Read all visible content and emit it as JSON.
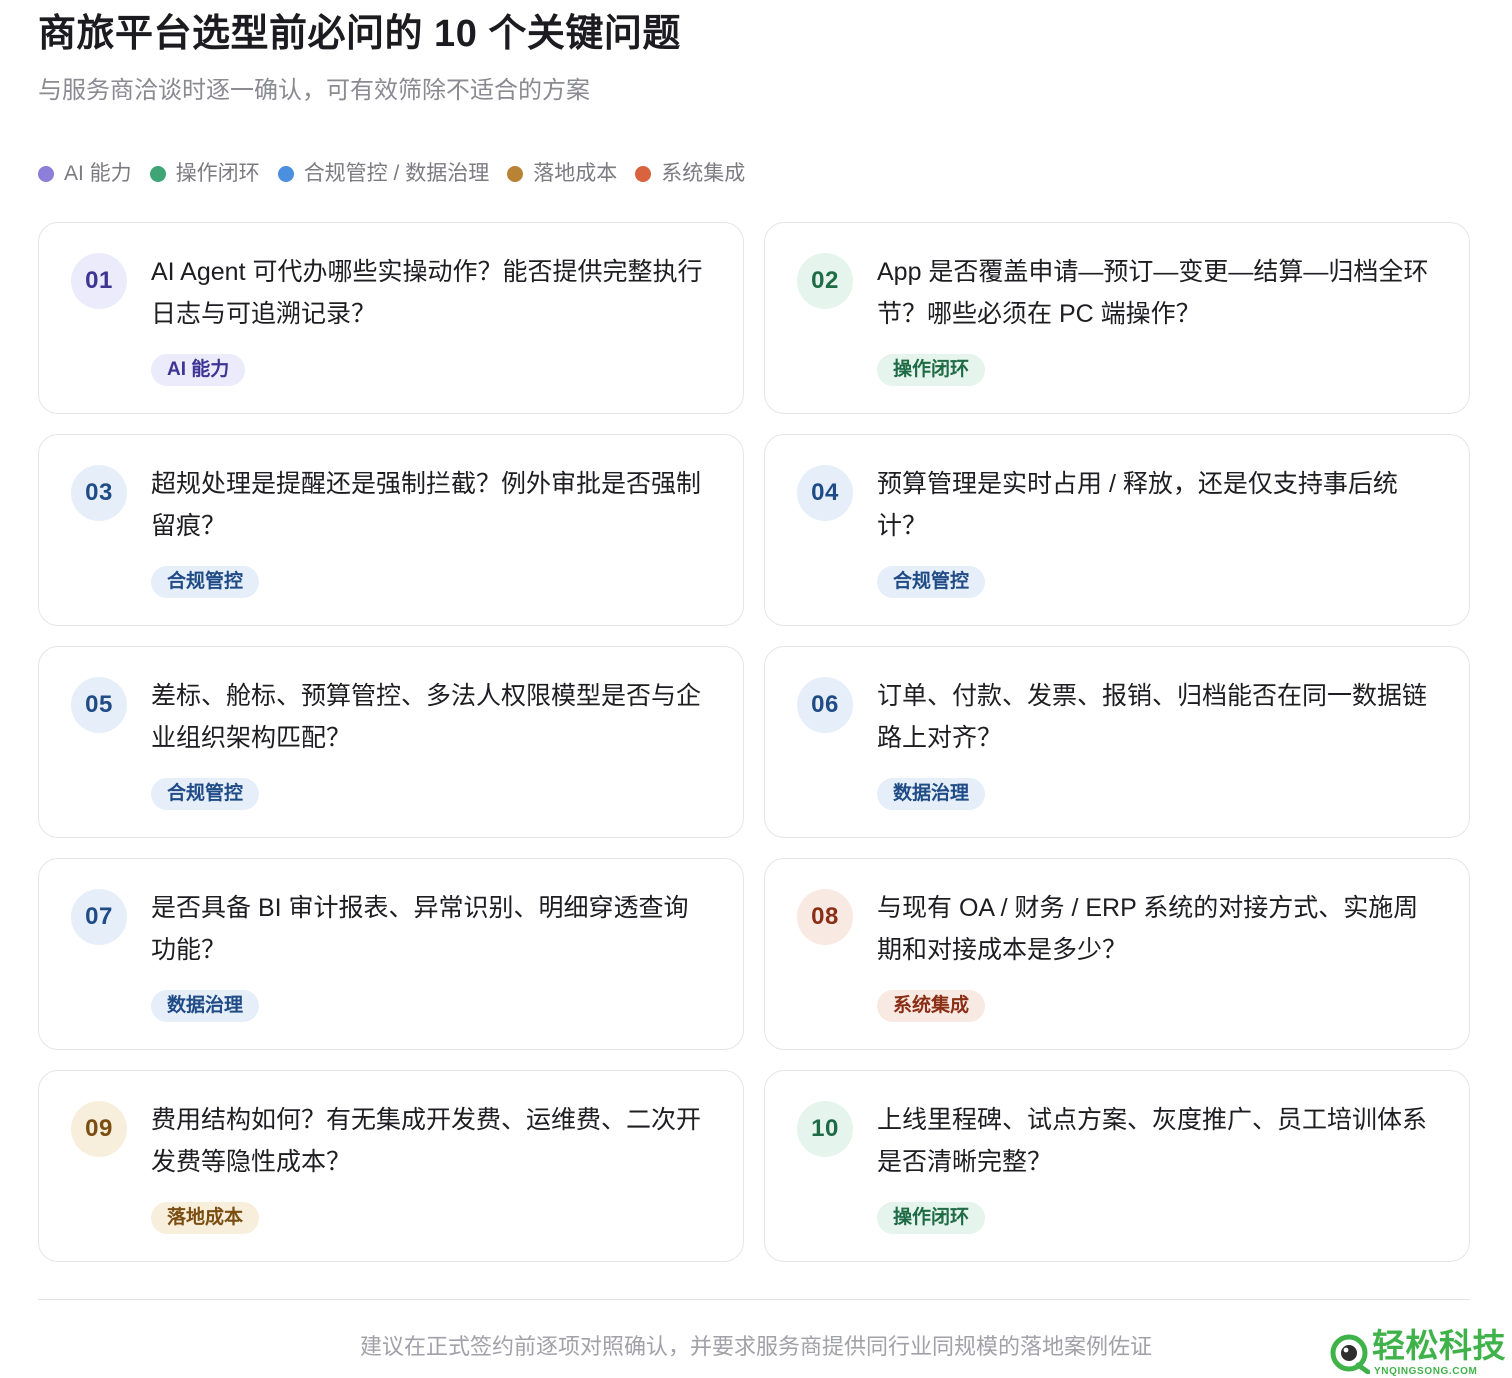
{
  "header": {
    "title": "商旅平台选型前必问的 10 个关键问题",
    "subtitle": "与服务商洽谈时逐一确认，可有效筛除不适合的方案"
  },
  "legend": [
    {
      "label": "AI 能力",
      "color": "#8b7fd9"
    },
    {
      "label": "操作闭环",
      "color": "#3fa476"
    },
    {
      "label": "合规管控 / 数据治理",
      "color": "#4a8fe0"
    },
    {
      "label": "落地成本",
      "color": "#b88335"
    },
    {
      "label": "系统集成",
      "color": "#d9623f"
    }
  ],
  "categories": {
    "ai": {
      "badge_bg": "#ecebfb",
      "badge_fg": "#3d3493",
      "tag_bg": "#ecebfb",
      "tag_fg": "#3d3493"
    },
    "ops": {
      "badge_bg": "#e5f4ec",
      "badge_fg": "#1f6b45",
      "tag_bg": "#e5f4ec",
      "tag_fg": "#1f6b45"
    },
    "compliance": {
      "badge_bg": "#e6eef9",
      "badge_fg": "#1f4b86",
      "tag_bg": "#e6eef9",
      "tag_fg": "#1f4b86"
    },
    "cost": {
      "badge_bg": "#f8eedc",
      "badge_fg": "#7a4d10",
      "tag_bg": "#f8eedc",
      "tag_fg": "#7a4d10"
    },
    "integration": {
      "badge_bg": "#f9e9e3",
      "badge_fg": "#8a2f15",
      "tag_bg": "#f9e9e3",
      "tag_fg": "#8a2f15"
    }
  },
  "cards": [
    {
      "num": "01",
      "question": "AI Agent 可代办哪些实操动作？能否提供完整执行日志与可追溯记录？",
      "tag": "AI 能力",
      "category": "ai"
    },
    {
      "num": "02",
      "question": "App 是否覆盖申请—预订—变更—结算—归档全环节？哪些必须在 PC 端操作？",
      "tag": "操作闭环",
      "category": "ops"
    },
    {
      "num": "03",
      "question": "超规处理是提醒还是强制拦截？例外审批是否强制留痕？",
      "tag": "合规管控",
      "category": "compliance"
    },
    {
      "num": "04",
      "question": "预算管理是实时占用 / 释放，还是仅支持事后统计？",
      "tag": "合规管控",
      "category": "compliance"
    },
    {
      "num": "05",
      "question": "差标、舱标、预算管控、多法人权限模型是否与企业组织架构匹配？",
      "tag": "合规管控",
      "category": "compliance"
    },
    {
      "num": "06",
      "question": "订单、付款、发票、报销、归档能否在同一数据链路上对齐？",
      "tag": "数据治理",
      "category": "compliance"
    },
    {
      "num": "07",
      "question": "是否具备 BI 审计报表、异常识别、明细穿透查询功能？",
      "tag": "数据治理",
      "category": "compliance"
    },
    {
      "num": "08",
      "question": "与现有 OA / 财务 / ERP 系统的对接方式、实施周期和对接成本是多少？",
      "tag": "系统集成",
      "category": "integration"
    },
    {
      "num": "09",
      "question": "费用结构如何？有无集成开发费、运维费、二次开发费等隐性成本？",
      "tag": "落地成本",
      "category": "cost"
    },
    {
      "num": "10",
      "question": "上线里程碑、试点方案、灰度推广、员工培训体系是否清晰完整？",
      "tag": "操作闭环",
      "category": "ops"
    }
  ],
  "footer": {
    "note": "建议在正式签约前逐项对照确认，并要求服务商提供同行业同规模的落地案例佐证"
  },
  "watermark": {
    "name": "轻松科技",
    "domain": "YNQINGSONG.COM"
  }
}
